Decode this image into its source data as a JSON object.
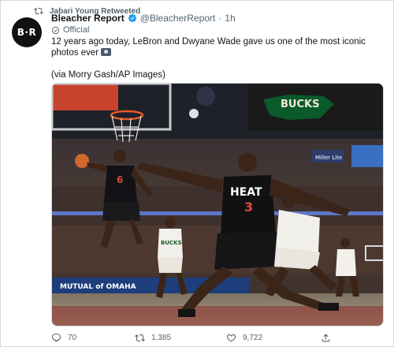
{
  "retweet_context": {
    "icon": "retweet-icon",
    "text": "Jabari Young Retweeted"
  },
  "author": {
    "avatar_text": "B·R",
    "name": "Bleacher Report",
    "verified_icon": "verified-badge-icon",
    "handle": "@BleacherReport",
    "separator": "·",
    "time": "1h",
    "label": "Official",
    "label_icon": "official-icon"
  },
  "tweet": {
    "line1": "12 years ago today, LeBron and Dwyane Wade gave us one of the most iconic photos ever",
    "line2": "(via Morry Gash/AP Images)"
  },
  "media": {
    "court_text_top": "BUCKS",
    "sideline_text": "MUTUAL of OMAHA",
    "jersey_left": "6",
    "jersey_right_team": "HEAT",
    "jersey_right_number": "3",
    "arena_sign": "Miller Lite",
    "bucks_jersey": "BUCKS"
  },
  "actions": {
    "replies": "70",
    "retweets": "1,385",
    "likes": "9,722",
    "reply_icon": "reply-icon",
    "retweet_icon": "retweet-icon",
    "like_icon": "heart-icon",
    "share_icon": "share-icon"
  },
  "colors": {
    "link": "#1d9bf0",
    "muted": "#536471",
    "text": "#0f1419"
  }
}
